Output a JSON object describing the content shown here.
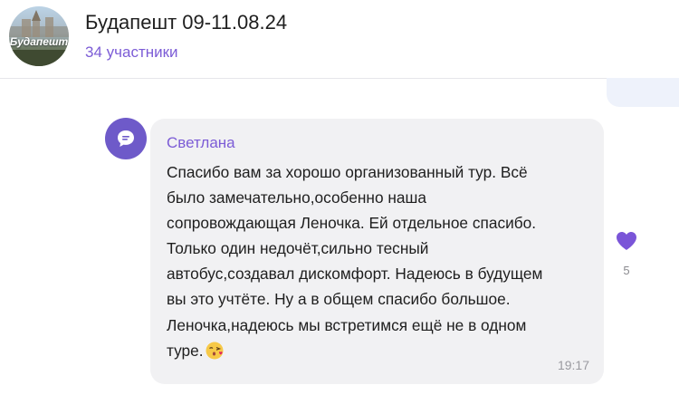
{
  "header": {
    "title": "Будапешт 09-11.08.24",
    "members": "34 участники",
    "avatar_text": "Будапешт"
  },
  "message": {
    "sender": "Светлана",
    "lines": [
      "Спасибо вам за хорошо организованный тур. Всё",
      "было замечательно,особенно наша",
      "сопровождающая Леночка. Ей отдельное спасибо.",
      "Только один недочёт,сильно тесный",
      "автобус,создавал дискомфорт. Надеюсь в будущем",
      "вы это учтёте. Ну а в общем спасибо большое.",
      "Леночка,надеюсь мы встретимся ещё не в одном",
      "туре."
    ],
    "time": "19:17",
    "reaction": {
      "icon": "heart-icon",
      "count": "5"
    }
  },
  "colors": {
    "accent": "#7c5cd6",
    "avatar_bg": "#6e5ac9",
    "bubble_bg": "#f1f1f3",
    "reaction": "#7a55d8"
  }
}
